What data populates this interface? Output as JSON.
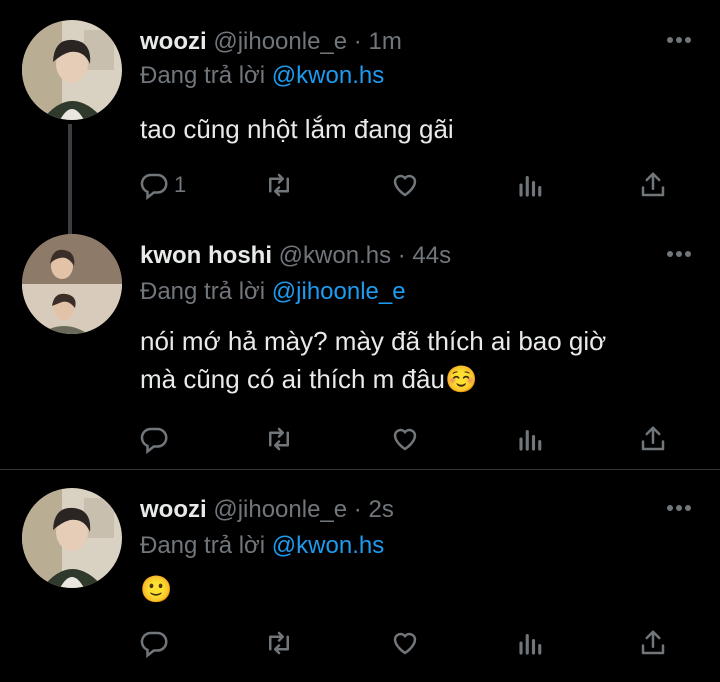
{
  "tweets": [
    {
      "name": "woozi",
      "handle": "@jihoonle_e",
      "dot": "·",
      "time": "1m",
      "replying_prefix": "Đang trả lời",
      "replying_to": "@kwon.hs",
      "text_lines": [
        "tao cũng nhột lắm đang gãi"
      ],
      "reply_count": "1"
    },
    {
      "name": "kwon hoshi",
      "handle": "@kwon.hs",
      "dot": "·",
      "time": "44s",
      "replying_prefix": "Đang trả lời",
      "replying_to": "@jihoonle_e",
      "text_lines": [
        "nói mớ hả mày? mày đã thích ai bao giờ",
        "mà cũng có ai thích m đâu☺️"
      ],
      "reply_count": ""
    },
    {
      "name": "woozi",
      "handle": "@jihoonle_e",
      "dot": "·",
      "time": "2s",
      "replying_prefix": "Đang trả lời",
      "replying_to": "@kwon.hs",
      "text_lines": [
        "🙂"
      ],
      "reply_count": ""
    }
  ],
  "colors": {
    "background": "#000000",
    "text": "#e7e9ea",
    "secondary": "#71767b",
    "mention": "#1d9bf0",
    "thread_line": "#3a3d41"
  },
  "icons": [
    "reply-icon",
    "retweet-icon",
    "like-icon",
    "views-icon",
    "share-icon",
    "more-icon"
  ]
}
